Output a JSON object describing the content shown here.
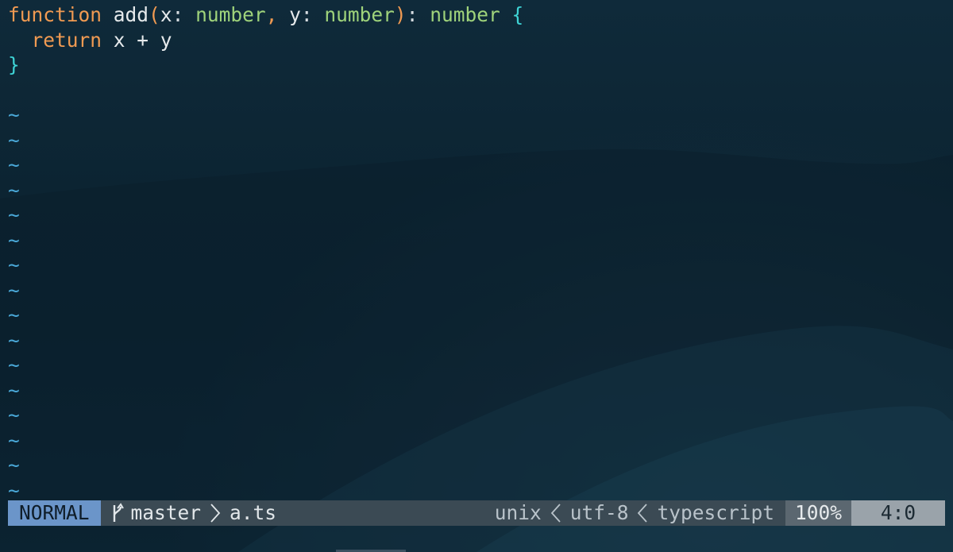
{
  "editor": {
    "code": [
      [
        {
          "t": "function",
          "c": "kw"
        },
        {
          "t": " ",
          "c": "punct"
        },
        {
          "t": "add",
          "c": "fn"
        },
        {
          "t": "(",
          "c": "paren"
        },
        {
          "t": "x",
          "c": "ident"
        },
        {
          "t": ": ",
          "c": "punct"
        },
        {
          "t": "number",
          "c": "type"
        },
        {
          "t": ", ",
          "c": "paren"
        },
        {
          "t": "y",
          "c": "ident"
        },
        {
          "t": ": ",
          "c": "punct"
        },
        {
          "t": "number",
          "c": "type"
        },
        {
          "t": ")",
          "c": "paren"
        },
        {
          "t": ": ",
          "c": "punct"
        },
        {
          "t": "number",
          "c": "type"
        },
        {
          "t": " ",
          "c": "punct"
        },
        {
          "t": "{",
          "c": "brace"
        }
      ],
      [
        {
          "t": "  ",
          "c": "punct"
        },
        {
          "t": "return",
          "c": "kw"
        },
        {
          "t": " x + y",
          "c": "ident"
        }
      ],
      [
        {
          "t": "}",
          "c": "brace"
        }
      ],
      []
    ],
    "tilde_char": "~",
    "tilde_count": 16
  },
  "statusline": {
    "mode": "NORMAL",
    "branch_icon": "git-branch-icon",
    "branch": "master",
    "filename": "a.ts",
    "fileformat": "unix",
    "encoding": "utf-8",
    "filetype": "typescript",
    "percent": "100%",
    "position": "4:0"
  },
  "colors": {
    "keyword": "#f09a52",
    "type": "#9fd37b",
    "brace": "#3ed3d5",
    "tilde": "#4aa9d9",
    "mode_bg": "#6b95c9",
    "statusline_bg": "#3b4a54"
  }
}
